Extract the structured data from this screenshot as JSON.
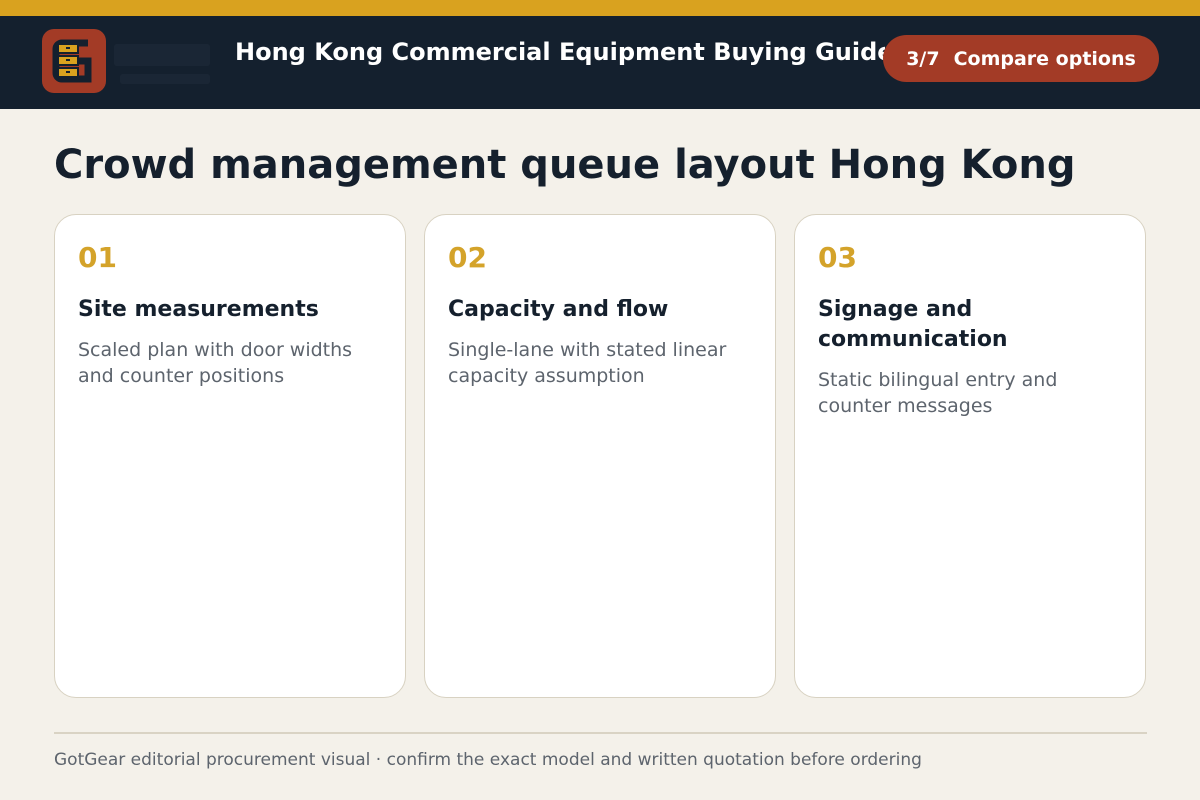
{
  "header": {
    "title": "Hong Kong Commercial Equipment Buying Guide",
    "step": "3/7",
    "step_label": "Compare options",
    "logo_icon": "gotgear-logo-icon"
  },
  "page_title": "Crowd management queue layout Hong Kong",
  "cards": [
    {
      "number": "01",
      "title": "Site measurements",
      "description": "Scaled plan with door widths and counter positions"
    },
    {
      "number": "02",
      "title": "Capacity and flow",
      "description": "Single-lane with stated linear capacity assumption"
    },
    {
      "number": "03",
      "title": "Signage and communication",
      "description": "Static bilingual entry and counter messages"
    }
  ],
  "footer": "GotGear editorial procurement visual · confirm the exact model and written quotation before ordering",
  "colors": {
    "accent_gold": "#d9a21f",
    "header_navy": "#14202e",
    "pill_red": "#a33b26",
    "background": "#f4f1ea"
  }
}
